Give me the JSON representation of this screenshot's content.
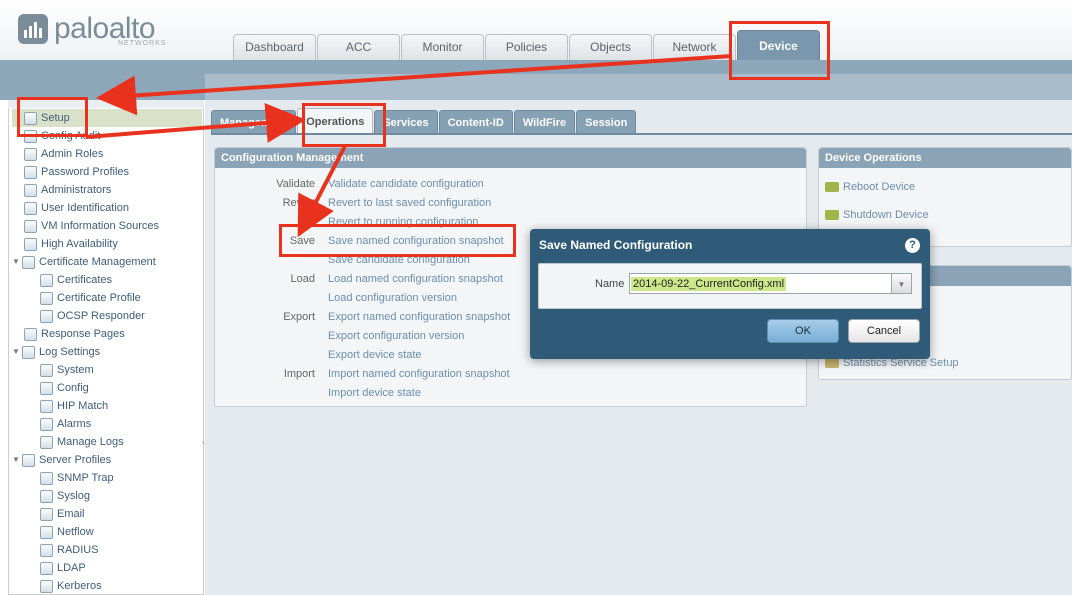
{
  "brand": {
    "name": "paloalto",
    "sub": "NETWORKS"
  },
  "top_tabs": [
    "Dashboard",
    "ACC",
    "Monitor",
    "Policies",
    "Objects",
    "Network",
    "Device"
  ],
  "sidebar": {
    "items": [
      {
        "label": "Setup"
      },
      {
        "label": "Config Audit"
      },
      {
        "label": "Admin Roles"
      },
      {
        "label": "Password Profiles"
      },
      {
        "label": "Administrators"
      },
      {
        "label": "User Identification"
      },
      {
        "label": "VM Information Sources"
      },
      {
        "label": "High Availability"
      },
      {
        "label": "Certificate Management"
      },
      {
        "label": "Certificates"
      },
      {
        "label": "Certificate Profile"
      },
      {
        "label": "OCSP Responder"
      },
      {
        "label": "Response Pages"
      },
      {
        "label": "Log Settings"
      },
      {
        "label": "System"
      },
      {
        "label": "Config"
      },
      {
        "label": "HIP Match"
      },
      {
        "label": "Alarms"
      },
      {
        "label": "Manage Logs"
      },
      {
        "label": "Server Profiles"
      },
      {
        "label": "SNMP Trap"
      },
      {
        "label": "Syslog"
      },
      {
        "label": "Email"
      },
      {
        "label": "Netflow"
      },
      {
        "label": "RADIUS"
      },
      {
        "label": "LDAP"
      },
      {
        "label": "Kerberos"
      }
    ]
  },
  "sub_tabs": [
    "Management",
    "Operations",
    "Services",
    "Content-ID",
    "WildFire",
    "Session"
  ],
  "config_management": {
    "title": "Configuration Management",
    "rows": [
      {
        "label": "Validate",
        "link": "Validate candidate configuration"
      },
      {
        "label": "Revert",
        "link": "Revert to last saved configuration"
      },
      {
        "label": "",
        "link": "Revert to running configuration"
      },
      {
        "label": "Save",
        "link": "Save named configuration snapshot"
      },
      {
        "label": "",
        "link": "Save candidate configuration"
      },
      {
        "label": "Load",
        "link": "Load named configuration snapshot"
      },
      {
        "label": "",
        "link": "Load configuration version"
      },
      {
        "label": "Export",
        "link": "Export named configuration snapshot"
      },
      {
        "label": "",
        "link": "Export configuration version"
      },
      {
        "label": "",
        "link": "Export device state"
      },
      {
        "label": "Import",
        "link": "Import named configuration snapshot"
      },
      {
        "label": "",
        "link": "Import device state"
      }
    ]
  },
  "device_operations": {
    "title": "Device Operations",
    "items": [
      "Reboot Device",
      "Shutdown Device"
    ]
  },
  "misc_panel": {
    "item": "Statistics Service Setup"
  },
  "modal": {
    "title": "Save Named Configuration",
    "help": "?",
    "name_label": "Name",
    "name_value": "2014-09-22_CurrentConfig.xml",
    "ok_label": "OK",
    "cancel_label": "Cancel"
  },
  "colors": {
    "annotation": "#e8321d",
    "accent": "#2f5a78",
    "tab_active": "#7b97ad"
  }
}
